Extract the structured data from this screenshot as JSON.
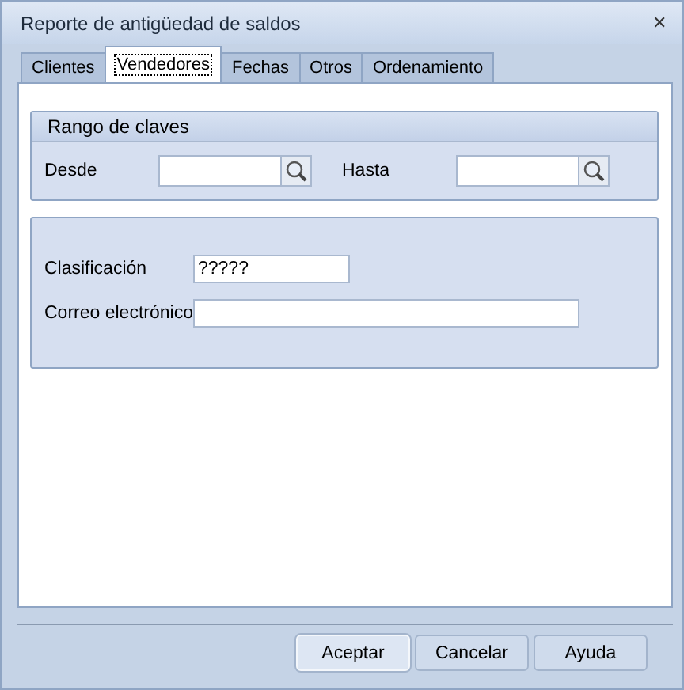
{
  "window": {
    "title": "Reporte de antigüedad de saldos",
    "close": "✕"
  },
  "tabs": [
    {
      "label": "Clientes",
      "selected": false
    },
    {
      "label": "Vendedores",
      "selected": true
    },
    {
      "label": "Fechas",
      "selected": false
    },
    {
      "label": "Otros",
      "selected": false
    },
    {
      "label": "Ordenamiento",
      "selected": false
    }
  ],
  "range_group": {
    "title": "Rango de claves",
    "fields": [
      {
        "label": "Desde"
      },
      {
        "label": "Hasta"
      }
    ]
  },
  "fields": [
    {
      "label": "Clasificación",
      "value": "?????",
      "kind": "short"
    },
    {
      "label": "Correo electrónico",
      "kind": "long"
    }
  ],
  "buttons": [
    {
      "label": "Aceptar",
      "default": true
    },
    {
      "label": "Cancelar",
      "default": false
    },
    {
      "label": "Ayuda",
      "default": false
    }
  ]
}
